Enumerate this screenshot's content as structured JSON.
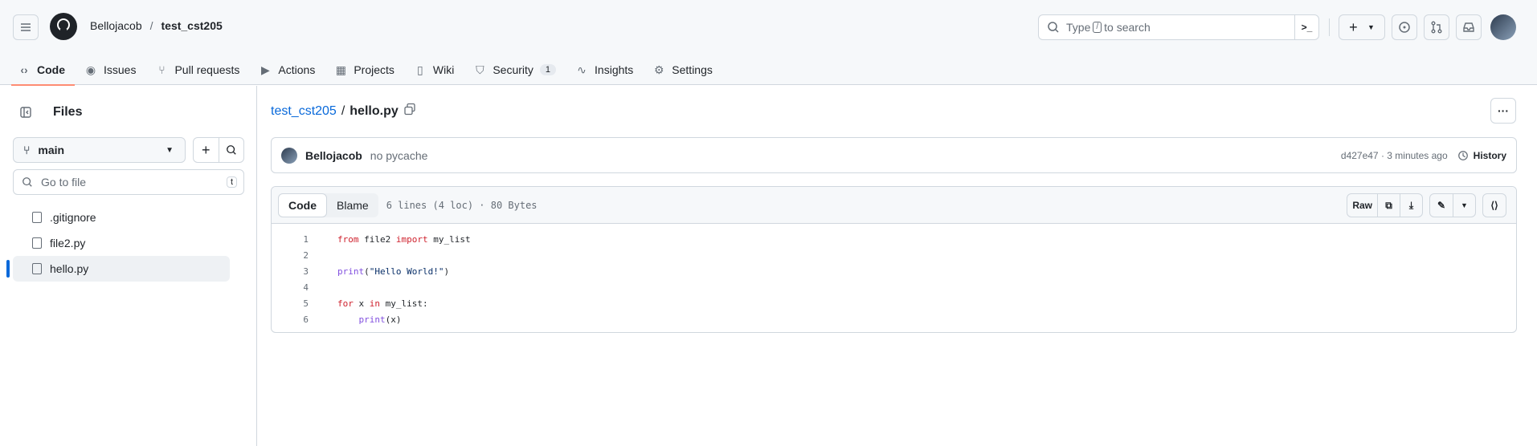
{
  "header": {
    "owner": "Bellojacob",
    "separator": "/",
    "repo": "test_cst205",
    "search_prefix": "Type",
    "search_key": "/",
    "search_suffix": "to search",
    "cmd_glyph": ">_",
    "plus_glyph": "+"
  },
  "tabs": [
    {
      "label": "Code",
      "icon": "code-icon"
    },
    {
      "label": "Issues",
      "icon": "issue-icon"
    },
    {
      "label": "Pull requests",
      "icon": "pull-request-icon"
    },
    {
      "label": "Actions",
      "icon": "play-icon"
    },
    {
      "label": "Projects",
      "icon": "table-icon"
    },
    {
      "label": "Wiki",
      "icon": "book-icon"
    },
    {
      "label": "Security",
      "icon": "shield-icon",
      "badge": "1"
    },
    {
      "label": "Insights",
      "icon": "graph-icon"
    },
    {
      "label": "Settings",
      "icon": "gear-icon"
    }
  ],
  "sidebar": {
    "title": "Files",
    "branch": "main",
    "goto_placeholder": "Go to file",
    "goto_key": "t",
    "files": [
      ".gitignore",
      "file2.py",
      "hello.py"
    ]
  },
  "file": {
    "repo": "test_cst205",
    "sep": "/",
    "name": "hello.py"
  },
  "commit": {
    "author": "Bellojacob",
    "message": "no pycache",
    "sha_time": "d427e47 · 3 minutes ago",
    "history": "History"
  },
  "code": {
    "tab_code": "Code",
    "tab_blame": "Blame",
    "meta": "6 lines (4 loc) · 80 Bytes",
    "raw": "Raw",
    "lines": [
      "1",
      "2",
      "3",
      "4",
      "5",
      "6"
    ]
  },
  "colors": {
    "accent": "#0969da",
    "active_tab_underline": "#fd8c73",
    "keyword": "#cf222e",
    "function": "#8250df",
    "string": "#0a3069"
  }
}
